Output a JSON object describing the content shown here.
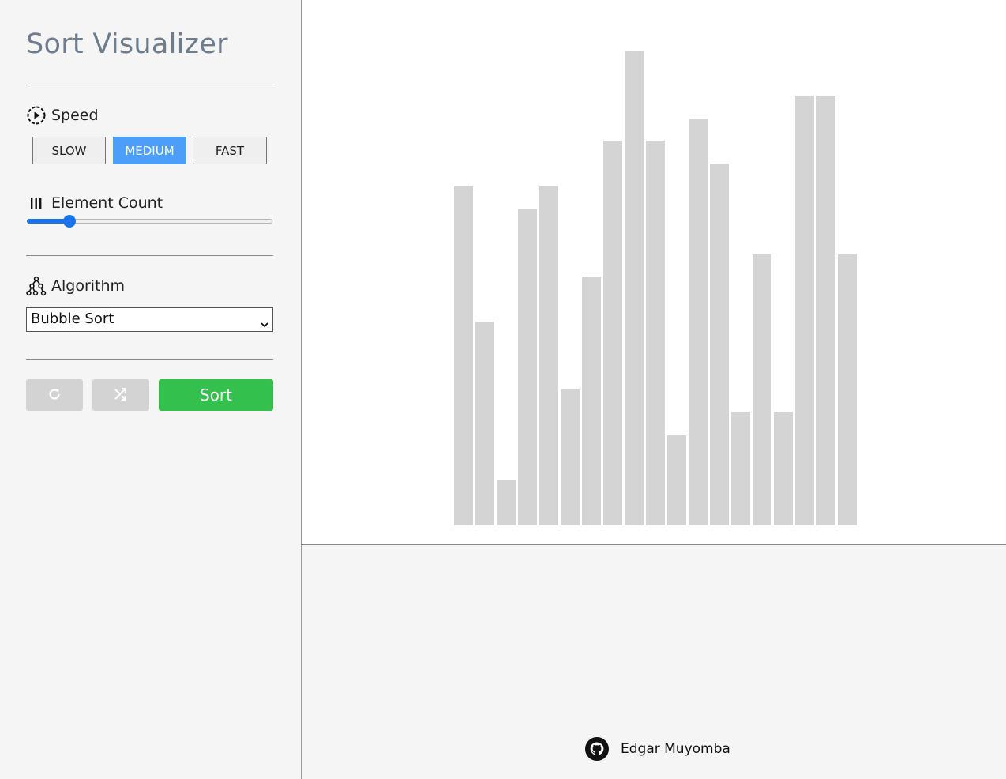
{
  "app": {
    "title": "Sort Visualizer"
  },
  "speed": {
    "label": "Speed",
    "icon": "play-circle-icon",
    "options": [
      "SLOW",
      "MEDIUM",
      "FAST"
    ],
    "selected": "MEDIUM",
    "active_color": "#4d9ef8"
  },
  "element_count": {
    "label": "Element Count",
    "icon": "bars-icon",
    "slider_fraction": 0.175
  },
  "algorithm": {
    "label": "Algorithm",
    "icon": "tree-icon",
    "selected": "Bubble Sort"
  },
  "actions": {
    "reset_icon": "refresh-icon",
    "shuffle_icon": "shuffle-icon",
    "sort_label": "Sort",
    "sort_color": "#34c04d"
  },
  "bars": {
    "color": "#d4d4d4",
    "values": [
      15,
      9,
      2,
      14,
      15,
      6,
      11,
      17,
      21,
      17,
      4,
      18,
      16,
      5,
      12,
      5,
      19,
      19,
      12
    ]
  },
  "footer": {
    "icon": "github-icon",
    "author": "Edgar Muyomba"
  }
}
